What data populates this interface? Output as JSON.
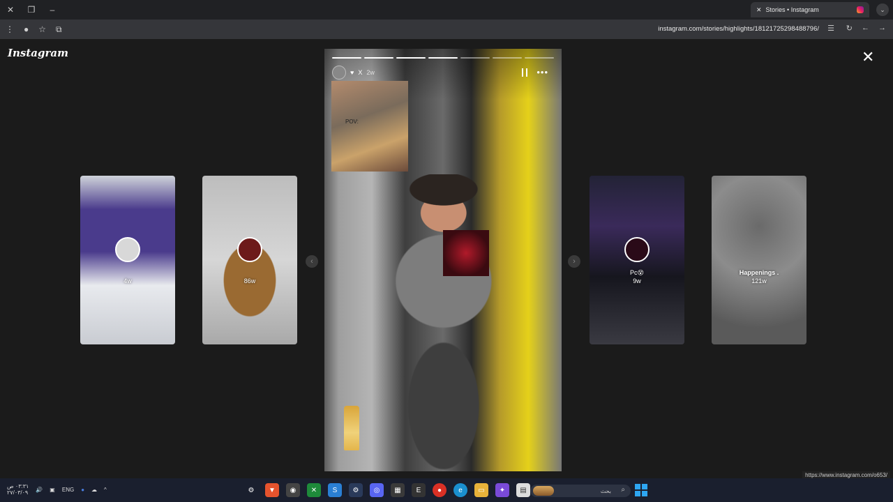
{
  "browser": {
    "tab_title": "Stories • Instagram",
    "url": "instagram.com/stories/highlights/18121725298488796/",
    "status_url": "https://www.instagram.com/o653/"
  },
  "page": {
    "logo": "Instagram",
    "close_label": "✕"
  },
  "main_story": {
    "user_label": "X",
    "time": "2w",
    "more_label": "•••",
    "sticker_caption": "POV:",
    "progress_segments": 7,
    "progress_done": 4
  },
  "side_stories": [
    {
      "label": "4w",
      "colors": [
        "#cfd3da",
        "#4a3b8c",
        "#e8eaee"
      ]
    },
    {
      "label": "86w",
      "colors": [
        "#d2d2d2",
        "#8b5a2b",
        "#b0b0b0"
      ]
    },
    {
      "label": "Pc😵",
      "colors": [
        "#1a1a2a",
        "#e0207a",
        "#3a3a4a"
      ]
    },
    {
      "label": "Happenings .",
      "sublabel": "121w",
      "colors": [
        "#8a8a8a",
        "#5a5a5a",
        "#a0a0a0"
      ]
    }
  ],
  "taskbar": {
    "clock_time": "٠٣:٣١ ص",
    "clock_date": "٢٧/٠٣/٠٩",
    "lang": "ENG",
    "search_placeholder": "بحث"
  },
  "icons": {
    "tab_close": "close-icon",
    "new_tab": "plus-icon",
    "prev_arrow": "chevron-left-icon",
    "next_arrow": "chevron-right-icon"
  }
}
